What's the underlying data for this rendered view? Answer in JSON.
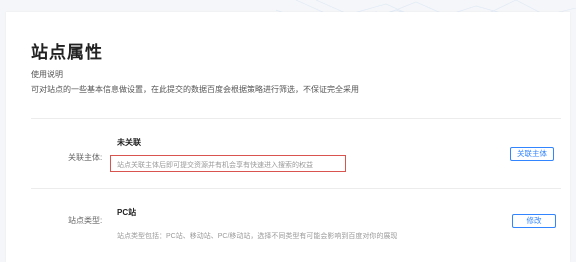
{
  "page": {
    "title": "站点属性",
    "usage_label": "使用说明",
    "usage_desc": "可对站点的一些基本信息做设置，在此提交的数据百度会根据策略进行筛选，不保证完全采用"
  },
  "rows": [
    {
      "label": "关联主体:",
      "value": "未关联",
      "hint": "站点关联主体后即可提交资源并有机会享有快速进入搜索的权益",
      "button": "关联主体"
    },
    {
      "label": "站点类型:",
      "value": "PC站",
      "hint": "站点类型包括：PC站、移动站、PC/移动站，选择不同类型有可能会影响到百度对你的展现",
      "button": "修改"
    }
  ],
  "colors": {
    "accent": "#3385ff",
    "highlight_border": "#d9534f"
  }
}
